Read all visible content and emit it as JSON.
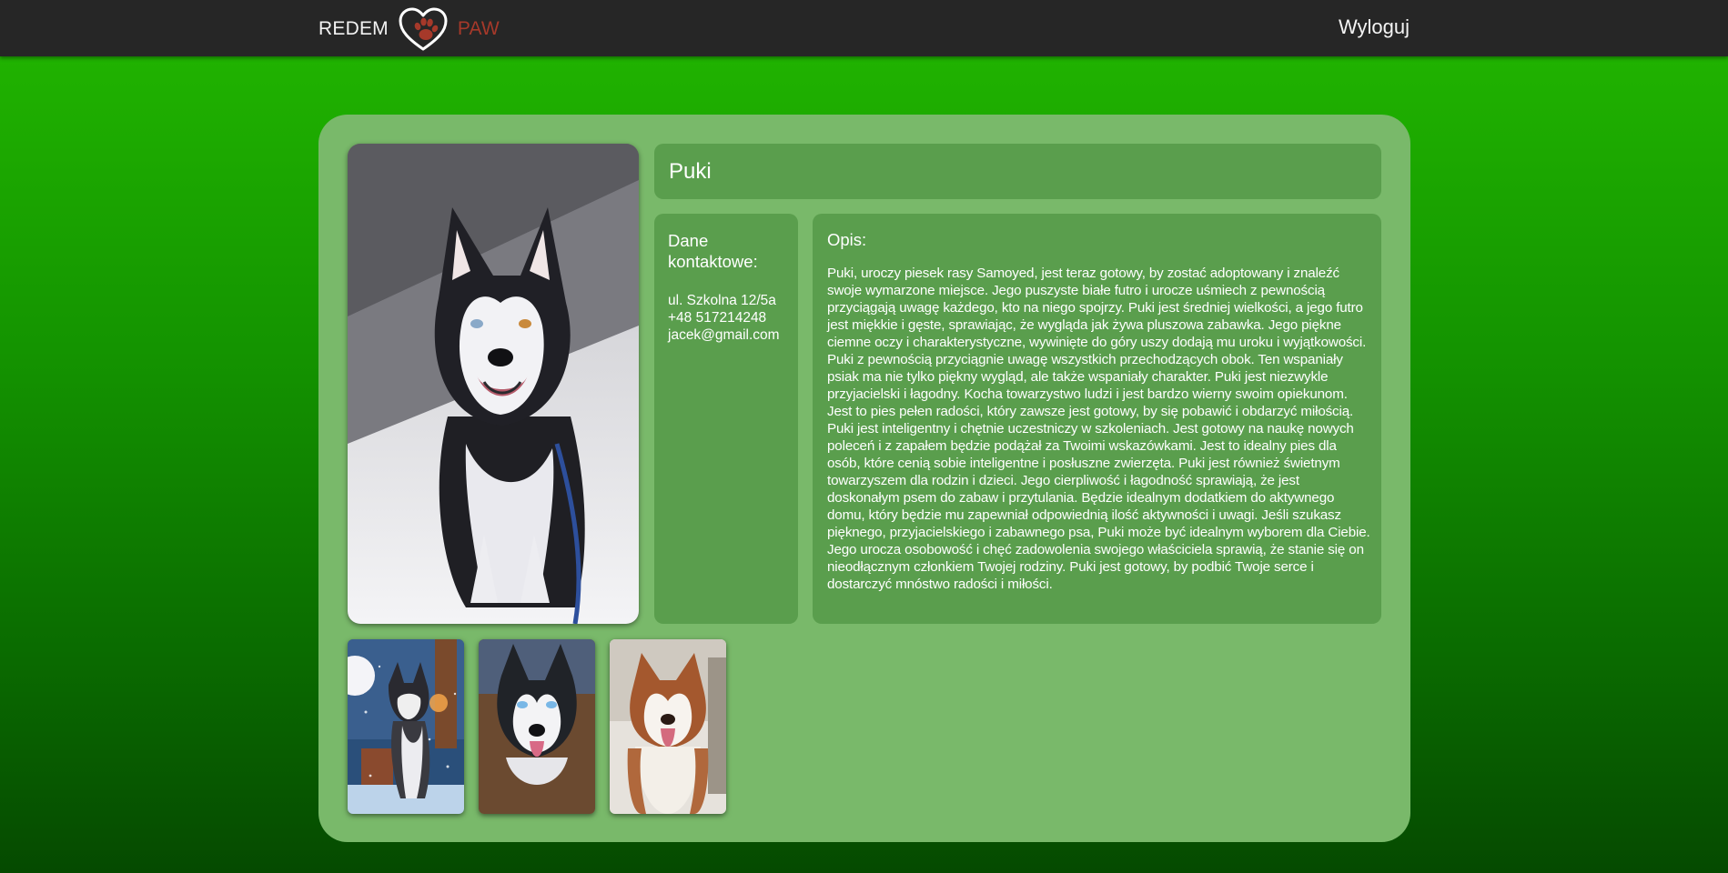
{
  "header": {
    "brand_left": "REDEM",
    "brand_right": "PAW",
    "logo_icon": "heart-paw-icon",
    "logout_label": "Wyloguj",
    "colors": {
      "bar": "#262626",
      "brand_right": "#a6392a"
    }
  },
  "pet": {
    "name": "Puki",
    "main_photo": "husky-sitting-photo",
    "contact": {
      "title": "Dane kontaktowe:",
      "address": "ul. Szkolna 12/5a",
      "phone": "+48 517214248",
      "email": "jacek@gmail.com"
    },
    "description": {
      "title": "Opis:",
      "text": "Puki, uroczy piesek rasy Samoyed, jest teraz gotowy, by zostać adoptowany i znaleźć swoje wymarzone miejsce. Jego puszyste białe futro i urocze uśmiech z pewnością przyciągają uwagę każdego, kto na niego spojrzy. Puki jest średniej wielkości, a jego futro jest miękkie i gęste, sprawiając, że wygląda jak żywa pluszowa zabawka. Jego piękne ciemne oczy i charakterystyczne, wywinięte do góry uszy dodają mu uroku i wyjątkowości. Puki z pewnością przyciągnie uwagę wszystkich przechodzących obok. Ten wspaniały psiak ma nie tylko piękny wygląd, ale także wspaniały charakter. Puki jest niezwykle przyjacielski i łagodny. Kocha towarzystwo ludzi i jest bardzo wierny swoim opiekunom. Jest to pies pełen radości, który zawsze jest gotowy, by się pobawić i obdarzyć miłością. Puki jest inteligentny i chętnie uczestniczy w szkoleniach. Jest gotowy na naukę nowych poleceń i z zapałem będzie podążał za Twoimi wskazówkami. Jest to idealny pies dla osób, które cenią sobie inteligentne i posłuszne zwierzęta. Puki jest również świetnym towarzyszem dla rodzin i dzieci. Jego cierpliwość i łagodność sprawiają, że jest doskonałym psem do zabaw i przytulania. Będzie idealnym dodatkiem do aktywnego domu, który będzie mu zapewniał odpowiednią ilość aktywności i uwagi. Jeśli szukasz pięknego, przyjacielskiego i zabawnego psa, Puki może być idealnym wyborem dla Ciebie. Jego urocza osobowość i chęć zadowolenia swojego właściciela sprawią, że stanie się on nieodłącznym członkiem Twojej rodziny. Puki jest gotowy, by podbić Twoje serce i dostarczyć mnóstwo radości i miłości."
    },
    "thumbnails": [
      "husky-winter-photo",
      "husky-puppy-photo",
      "brown-husky-photo"
    ]
  }
}
